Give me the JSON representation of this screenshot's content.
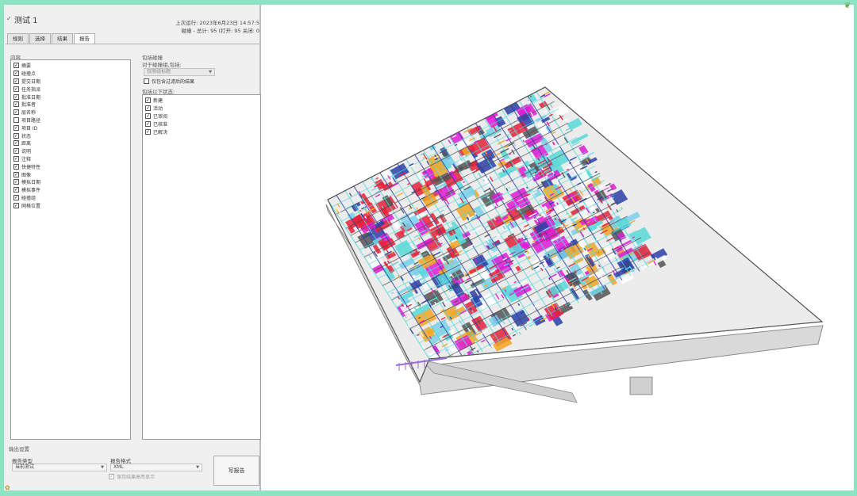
{
  "header": {
    "title": "测试 1",
    "last_run_label": "上次运行:",
    "last_run": "2023年6月23日 14:57:5",
    "summary": "碰撞 - 总计: 95 (打开: 95 关闭: 0"
  },
  "tabs": [
    "规则",
    "选择",
    "结果",
    "报告"
  ],
  "active_tab": 3,
  "contents": {
    "label": "内容",
    "items": [
      {
        "label": "摘要",
        "checked": true
      },
      {
        "label": "碰撞点",
        "checked": true
      },
      {
        "label": "提交日期",
        "checked": true
      },
      {
        "label": "任务指派",
        "checked": true
      },
      {
        "label": "批准日期",
        "checked": true
      },
      {
        "label": "批准者",
        "checked": true
      },
      {
        "label": "层名称",
        "checked": true
      },
      {
        "label": "项目路径",
        "checked": false
      },
      {
        "label": "项目 ID",
        "checked": true
      },
      {
        "label": "状态",
        "checked": true
      },
      {
        "label": "距离",
        "checked": true
      },
      {
        "label": "说明",
        "checked": true
      },
      {
        "label": "注释",
        "checked": true
      },
      {
        "label": "快捷特性",
        "checked": true
      },
      {
        "label": "图像",
        "checked": true
      },
      {
        "label": "模拟日期",
        "checked": true
      },
      {
        "label": "模拟事件",
        "checked": true
      },
      {
        "label": "碰撞组",
        "checked": true
      },
      {
        "label": "网格位置",
        "checked": true
      }
    ]
  },
  "include_clashes": {
    "label": "包括碰撞",
    "for_groups_label": "对于碰撞组,包括:",
    "for_groups_value": "仅限组标题",
    "only_filtered_label": "仅包含过滤后的结果",
    "status_label": "包括以下状态:",
    "statuses": [
      {
        "label": "新建",
        "checked": true
      },
      {
        "label": "活动",
        "checked": true
      },
      {
        "label": "已审阅",
        "checked": true
      },
      {
        "label": "已核准",
        "checked": true
      },
      {
        "label": "已解决",
        "checked": true
      }
    ]
  },
  "output": {
    "label": "输出设置",
    "report_type_label": "报告类型",
    "report_type": "当前测试",
    "report_format_label": "报告格式",
    "report_format": "XML",
    "keep_results_label": "保持结果高亮显示",
    "write_button": "写报告"
  },
  "icons": {
    "dropdown": "chevron-down-icon",
    "check": "checkmark-icon"
  },
  "colors": {
    "page_border": "#8ee3c3",
    "panel_bg": "#f0f0f0",
    "model_red": "#e8213a",
    "model_magenta": "#e01ad6",
    "model_cyan": "#59d9d9",
    "model_blue": "#2c3fa8"
  }
}
